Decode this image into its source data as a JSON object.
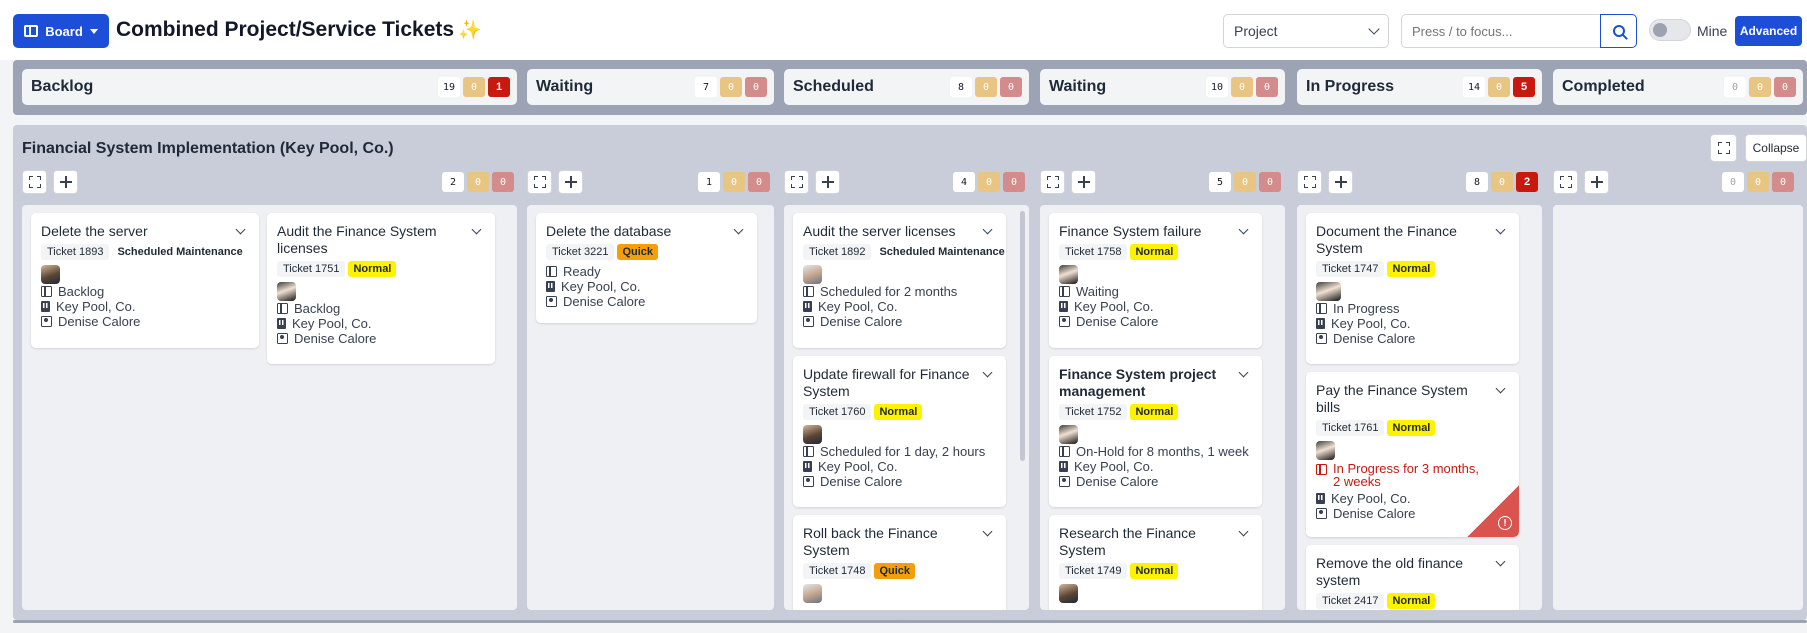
{
  "header": {
    "board_label": "Board",
    "title": "Combined Project/Service Tickets",
    "title_emoji": "✨",
    "project_select": "Project",
    "search_placeholder": "Press / to focus...",
    "mine_label": "Mine",
    "advanced_label": "Advanced"
  },
  "stages": [
    {
      "name": "Backlog",
      "counts": [
        "19",
        "0",
        "1"
      ]
    },
    {
      "name": "Waiting",
      "counts": [
        "7",
        "0",
        "0"
      ]
    },
    {
      "name": "Scheduled",
      "counts": [
        "8",
        "0",
        "0"
      ]
    },
    {
      "name": "Waiting",
      "counts": [
        "10",
        "0",
        "0"
      ]
    },
    {
      "name": "In Progress",
      "counts": [
        "14",
        "0",
        "5"
      ]
    },
    {
      "name": "Completed",
      "counts": [
        "0",
        "0",
        "0"
      ]
    }
  ],
  "lane": {
    "title": "Financial System Implementation (Key Pool, Co.)",
    "collapse_label": "Collapse",
    "column_counts": [
      [
        "2",
        "0",
        "0"
      ],
      [
        "1",
        "0",
        "0"
      ],
      [
        "4",
        "0",
        "0"
      ],
      [
        "5",
        "0",
        "0"
      ],
      [
        "8",
        "0",
        "2"
      ],
      [
        "0",
        "0",
        "0"
      ]
    ]
  },
  "cards": {
    "c1": {
      "title": "Delete the server",
      "ticket": "Ticket 1893",
      "type": "Scheduled Maintenance",
      "status": "Backlog",
      "company": "Key Pool, Co.",
      "owner": "Denise Calore"
    },
    "c2": {
      "title": "Audit the Finance System licenses",
      "ticket": "Ticket 1751",
      "type": "Normal",
      "status": "Backlog",
      "company": "Key Pool, Co.",
      "owner": "Denise Calore"
    },
    "c3": {
      "title": "Delete the database",
      "ticket": "Ticket 3221",
      "type": "Quick",
      "status": "Ready",
      "company": "Key Pool, Co.",
      "owner": "Denise Calore"
    },
    "c4": {
      "title": "Audit the server licenses",
      "ticket": "Ticket 1892",
      "type": "Scheduled Maintenance",
      "status": "Scheduled for 2 months",
      "company": "Key Pool, Co.",
      "owner": "Denise Calore"
    },
    "c5": {
      "title": "Update firewall for Finance System",
      "ticket": "Ticket 1760",
      "type": "Normal",
      "status": "Scheduled for 1 day, 2 hours",
      "company": "Key Pool, Co.",
      "owner": "Denise Calore"
    },
    "c6": {
      "title": "Roll back the Finance System",
      "ticket": "Ticket 1748",
      "type": "Quick"
    },
    "c7": {
      "title": "Finance System failure",
      "ticket": "Ticket 1758",
      "type": "Normal",
      "status": "Waiting",
      "company": "Key Pool, Co.",
      "owner": "Denise Calore"
    },
    "c8": {
      "title": "Finance System project management",
      "ticket": "Ticket 1752",
      "type": "Normal",
      "status": "On-Hold for 8 months, 1 week",
      "company": "Key Pool, Co.",
      "owner": "Denise Calore"
    },
    "c9": {
      "title": "Research the Finance System",
      "ticket": "Ticket 1749",
      "type": "Normal"
    },
    "c10": {
      "title": "Document the Finance System",
      "ticket": "Ticket 1747",
      "type": "Normal",
      "status": "In Progress",
      "company": "Key Pool, Co.",
      "owner": "Denise Calore"
    },
    "c11": {
      "title": "Pay the Finance System bills",
      "ticket": "Ticket 1761",
      "type": "Normal",
      "status": "In Progress for 3 months, 2 weeks",
      "company": "Key Pool, Co.",
      "owner": "Denise Calore",
      "warning_glyph": "!"
    },
    "c12": {
      "title": "Remove the old finance system",
      "ticket": "Ticket 2417",
      "type": "Normal"
    }
  },
  "colors": {
    "primary": "#1d4ed8",
    "normal": "#fff200",
    "quick": "#f59e0b",
    "alert": "#c8190e"
  }
}
